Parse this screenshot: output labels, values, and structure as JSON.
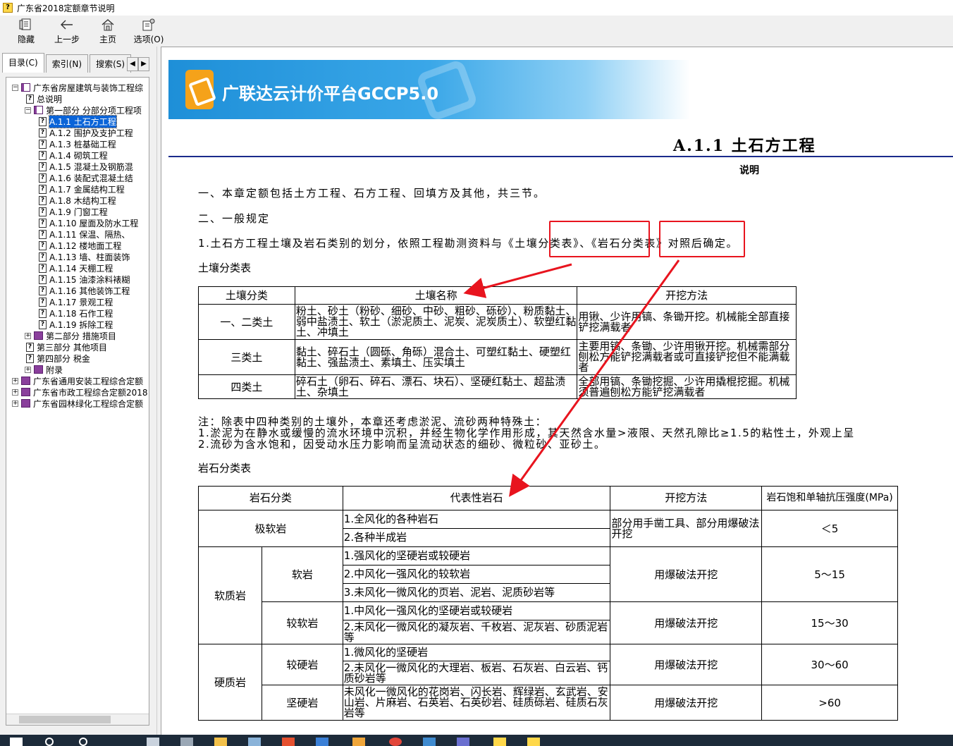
{
  "window": {
    "title": "广东省2018定额章节说明"
  },
  "toolbar": [
    {
      "label": "隐藏",
      "icon": "hide-icon"
    },
    {
      "label": "上一步",
      "icon": "back-arrow-icon"
    },
    {
      "label": "主页",
      "icon": "home-icon"
    },
    {
      "label": "选项(O)",
      "icon": "options-icon"
    }
  ],
  "tabs": [
    {
      "label": "目录(C)"
    },
    {
      "label": "索引(N)"
    },
    {
      "label": "搜索(S)"
    }
  ],
  "tree": [
    {
      "text": "广东省房屋建筑与装饰工程综",
      "level": 0,
      "kind": "book-open",
      "toggle": "−"
    },
    {
      "text": "总说明",
      "level": 1,
      "kind": "page",
      "toggle": ""
    },
    {
      "text": "第一部分  分部分项工程项",
      "level": 1,
      "kind": "book-open",
      "toggle": "−"
    },
    {
      "text": "A.1.1  土石方工程",
      "level": 2,
      "kind": "page",
      "toggle": "",
      "selected": true
    },
    {
      "text": "A.1.2  围护及支护工程",
      "level": 2,
      "kind": "page",
      "toggle": ""
    },
    {
      "text": "A.1.3  桩基础工程",
      "level": 2,
      "kind": "page",
      "toggle": ""
    },
    {
      "text": "A.1.4  砌筑工程",
      "level": 2,
      "kind": "page",
      "toggle": ""
    },
    {
      "text": "A.1.5  混凝土及钢筋混",
      "level": 2,
      "kind": "page",
      "toggle": ""
    },
    {
      "text": "A.1.6  装配式混凝土结",
      "level": 2,
      "kind": "page",
      "toggle": ""
    },
    {
      "text": "A.1.7  金属结构工程",
      "level": 2,
      "kind": "page",
      "toggle": ""
    },
    {
      "text": "A.1.8  木结构工程",
      "level": 2,
      "kind": "page",
      "toggle": ""
    },
    {
      "text": "A.1.9  门窗工程",
      "level": 2,
      "kind": "page",
      "toggle": ""
    },
    {
      "text": "A.1.10  屋面及防水工程",
      "level": 2,
      "kind": "page",
      "toggle": ""
    },
    {
      "text": "A.1.11  保温、隔热、",
      "level": 2,
      "kind": "page",
      "toggle": ""
    },
    {
      "text": "A.1.12  楼地面工程",
      "level": 2,
      "kind": "page",
      "toggle": ""
    },
    {
      "text": "A.1.13  墙、柱面装饰",
      "level": 2,
      "kind": "page",
      "toggle": ""
    },
    {
      "text": "A.1.14  天棚工程",
      "level": 2,
      "kind": "page",
      "toggle": ""
    },
    {
      "text": "A.1.15  油漆涂料裱糊",
      "level": 2,
      "kind": "page",
      "toggle": ""
    },
    {
      "text": "A.1.16  其他装饰工程",
      "level": 2,
      "kind": "page",
      "toggle": ""
    },
    {
      "text": "A.1.17  景观工程",
      "level": 2,
      "kind": "page",
      "toggle": ""
    },
    {
      "text": "A.1.18  石作工程",
      "level": 2,
      "kind": "page",
      "toggle": ""
    },
    {
      "text": "A.1.19  拆除工程",
      "level": 2,
      "kind": "page",
      "toggle": ""
    },
    {
      "text": "第二部分  措施项目",
      "level": 1,
      "kind": "book",
      "toggle": "+"
    },
    {
      "text": "第三部分  其他项目",
      "level": 1,
      "kind": "page",
      "toggle": ""
    },
    {
      "text": "第四部分  税金",
      "level": 1,
      "kind": "page",
      "toggle": ""
    },
    {
      "text": "附录",
      "level": 1,
      "kind": "book",
      "toggle": "+"
    },
    {
      "text": "广东省通用安装工程综合定额",
      "level": 0,
      "kind": "book",
      "toggle": "+"
    },
    {
      "text": "广东省市政工程综合定额2018",
      "level": 0,
      "kind": "book",
      "toggle": "+"
    },
    {
      "text": "广东省园林绿化工程综合定额",
      "level": 0,
      "kind": "book",
      "toggle": "+"
    }
  ],
  "banner": {
    "name": "广联达云计价平台GCCP5.0"
  },
  "doc": {
    "title": "A.1.1  土石方工程",
    "subtitle": "说明",
    "p1": "一、本章定额包括土方工程、石方工程、回填方及其他，共三节。",
    "p2": "二、一般规定",
    "p3": "1.土石方工程土壤及岩石类别的划分，依照工程勘测资料与《土壤分类表》、《岩石分类表》对照后确定。",
    "soil_caption": "土壤分类表",
    "note1": "注：除表中四种类别的土壤外，本章还考虑淤泥、流砂两种特殊土：",
    "note2": "1.淤泥为在静水或缓慢的流水环境中沉积，并经生物化学作用形成，其天然含水量>液限、天然孔隙比≥1.5的粘性土，外观上呈",
    "note3": "2.流砂为含水饱和，因受动水压力影响而呈流动状态的细砂、微粒砂、亚砂土。",
    "rock_caption": "岩石分类表"
  },
  "soil_table": {
    "headers": [
      "土壤分类",
      "土壤名称",
      "开挖方法"
    ],
    "rows": [
      {
        "cls": "一、二类土",
        "name": "粉土、砂土（粉砂、细砂、中砂、粗砂、砾砂）、粉质黏土、弱中盐渍土、软土（淤泥质土、泥炭、泥炭质土）、软塑红黏土、冲填土",
        "method": "用锹、少许用镐、条锄开挖。机械能全部直接铲挖满载者"
      },
      {
        "cls": "三类土",
        "name": "黏土、碎石土（圆砾、角砾）混合土、可塑红黏土、硬塑红黏土、强盐渍土、素填土、压实填土",
        "method": "主要用镐、条锄、少许用锹开挖。机械需部分刨松方能铲挖满载者或可直接铲挖但不能满载者"
      },
      {
        "cls": "四类土",
        "name": "碎石土（卵石、碎石、漂石、块石）、坚硬红黏土、超盐渍土、杂填土",
        "method": "全部用镐、条锄挖掘、少许用撬棍挖掘。机械须普遍刨松方能铲挖满载者"
      }
    ]
  },
  "rock_table": {
    "headers": [
      "岩石分类",
      "代表性岩石",
      "开挖方法",
      "岩石饱和单轴抗压强度(MPa)"
    ],
    "very_soft": {
      "cls": "极软岩",
      "rocks": [
        "1.全风化的各种岩石",
        "2.各种半成岩"
      ],
      "method": "部分用手凿工具、部分用爆破法开挖",
      "strength": "＜5"
    },
    "soft_group": "软质岩",
    "soft": {
      "sub": "软岩",
      "rocks": [
        "1.强风化的坚硬岩或较硬岩",
        "2.中风化一强风化的较软岩",
        "3.未风化一微风化的页岩、泥岩、泥质砂岩等"
      ],
      "method": "用爆破法开挖",
      "strength": "5～15"
    },
    "softer": {
      "sub": "较软岩",
      "rocks": [
        "1.中风化一强风化的坚硬岩或较硬岩",
        "2.未风化一微风化的凝灰岩、千枚岩、泥灰岩、砂质泥岩等"
      ],
      "method": "用爆破法开挖",
      "strength": "15～30"
    },
    "hard_group": "硬质岩",
    "harder": {
      "sub": "较硬岩",
      "rocks": [
        "1.微风化的坚硬岩",
        "2.未风化一微风化的大理岩、板岩、石灰岩、白云岩、钙质砂岩等"
      ],
      "method": "用爆破法开挖",
      "strength": "30～60"
    },
    "hard": {
      "sub": "坚硬岩",
      "rocks": [
        "未风化一微风化的花岗岩、闪长岩、辉绿岩、玄武岩、安山岩、片麻岩、石英岩、石英砂岩、硅质砾岩、硅质石灰岩等"
      ],
      "method": "用爆破法开挖",
      "strength": ">60"
    }
  },
  "colors": {
    "accent": "#1a2b8c",
    "annotation": "#e8141e",
    "selection": "#0a64d8"
  }
}
